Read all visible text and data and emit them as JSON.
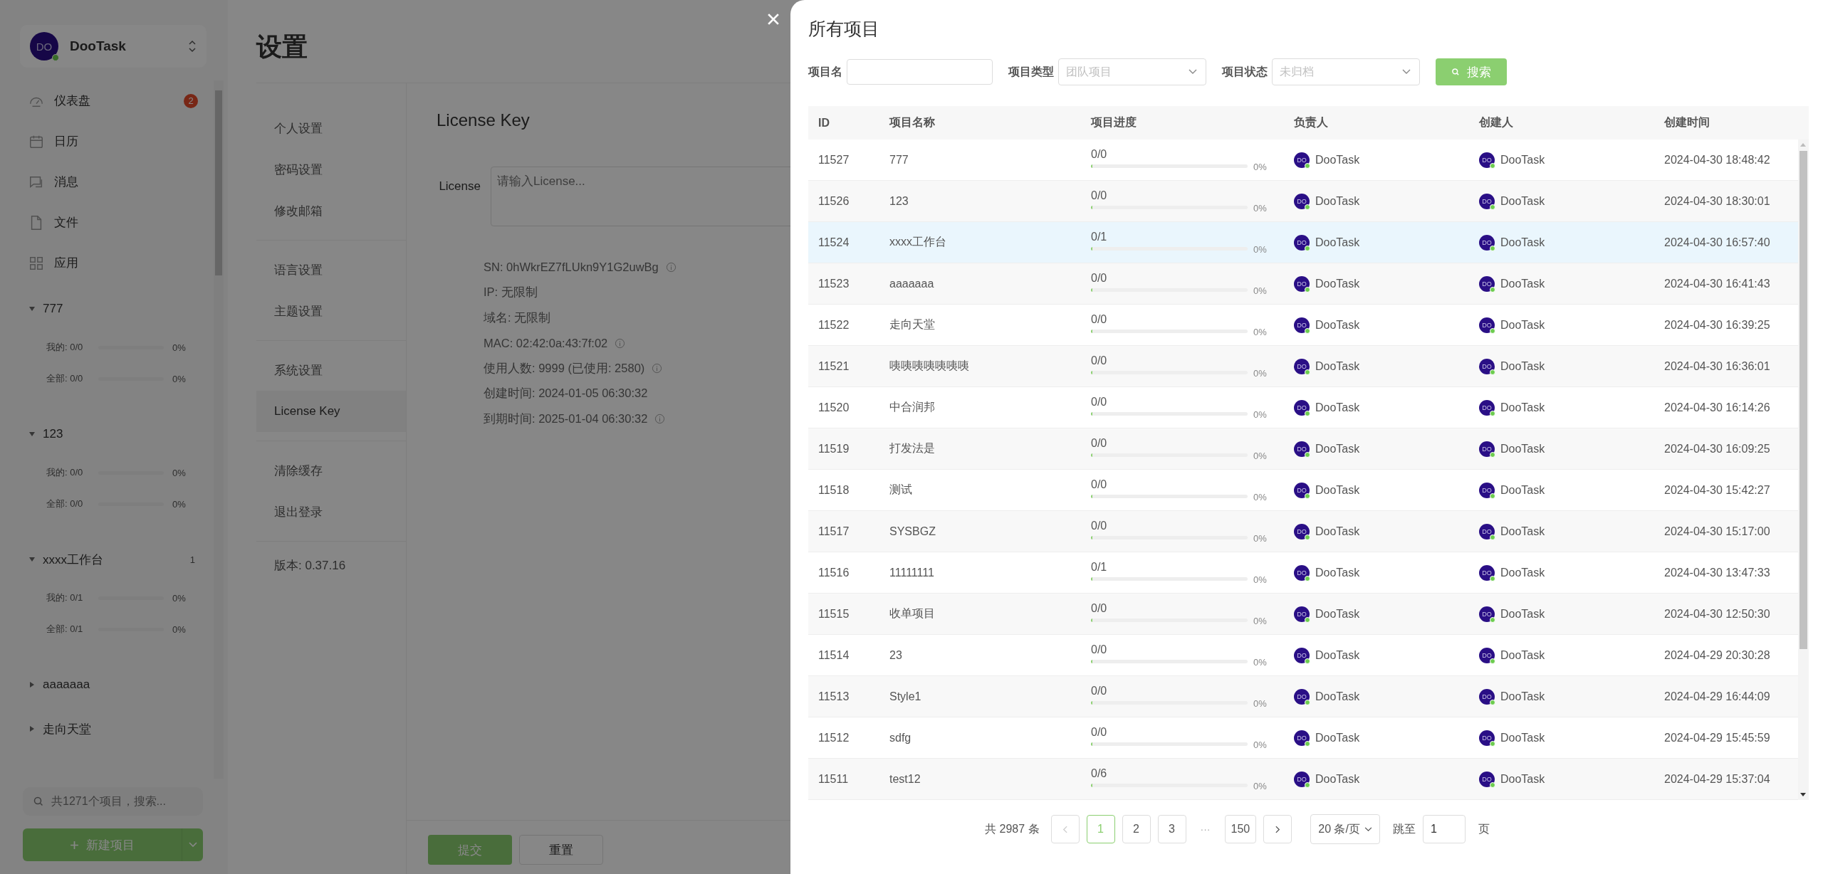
{
  "sidebar": {
    "logo": {
      "avatar": "DO",
      "name": "DooTask",
      "online": true
    },
    "menu": [
      {
        "kind": "dashboard",
        "label": "仪表盘",
        "badge": "2"
      },
      {
        "kind": "calendar",
        "label": "日历"
      },
      {
        "kind": "message",
        "label": "消息"
      },
      {
        "kind": "file",
        "label": "文件"
      },
      {
        "kind": "apps",
        "label": "应用"
      }
    ],
    "projects": [
      {
        "name": "777",
        "expanded": true,
        "stats": [
          {
            "label": "我的: 0/0",
            "level": 0,
            "percent": "0%"
          },
          {
            "label": "全部: 0/0",
            "level": 0,
            "percent": "0%"
          }
        ]
      },
      {
        "name": "123",
        "expanded": true,
        "stats": [
          {
            "label": "我的: 0/0",
            "level": 0,
            "percent": "0%"
          },
          {
            "label": "全部: 0/0",
            "level": 0,
            "percent": "0%"
          }
        ]
      },
      {
        "name": "xxxx工作台",
        "expanded": true,
        "count": "1",
        "stats": [
          {
            "label": "我的: 0/1",
            "level": 0,
            "percent": "0%"
          },
          {
            "label": "全部: 0/1",
            "level": 0,
            "percent": "0%"
          }
        ]
      },
      {
        "name": "aaaaaaa",
        "expanded": false
      },
      {
        "name": "走向天堂",
        "expanded": false
      }
    ],
    "search": {
      "placeholder": "共1271个项目，搜索..."
    },
    "new_button": {
      "label": "新建项目"
    }
  },
  "settings": {
    "title": "设置",
    "nav_groups": [
      [
        {
          "label": "个人设置",
          "selected": false
        },
        {
          "label": "密码设置",
          "selected": false
        },
        {
          "label": "修改邮箱",
          "selected": false
        }
      ],
      [
        {
          "label": "语言设置",
          "selected": false
        },
        {
          "label": "主题设置",
          "selected": false
        }
      ],
      [
        {
          "label": "系统设置",
          "selected": false
        },
        {
          "label": "License Key",
          "selected": true
        }
      ],
      [
        {
          "label": "清除缓存",
          "selected": false
        },
        {
          "label": "退出登录",
          "selected": false
        }
      ]
    ],
    "version": "版本: 0.37.16",
    "content": {
      "heading": "License Key",
      "license_label": "License",
      "license_placeholder": "请输入License...",
      "info": [
        {
          "label": "SN:",
          "value": "0hWkrEZ7fLUkn9Y1G2uwBg",
          "info_icon": true
        },
        {
          "label": "IP:",
          "value": "无限制",
          "info_icon": false
        },
        {
          "label": "域名:",
          "value": "无限制",
          "info_icon": false
        },
        {
          "label": "MAC:",
          "value": "02:42:0a:43:7f:02",
          "info_icon": true
        },
        {
          "label": "使用人数:",
          "value": "9999 (已使用: 2580)",
          "info_icon": true
        },
        {
          "label": "创建时间:",
          "value": "2024-01-05 06:30:32",
          "info_icon": false
        },
        {
          "label": "到期时间:",
          "value": "2025-01-04 06:30:32",
          "info_icon": true
        }
      ],
      "buttons": [
        {
          "kind": "primary",
          "label": "提交"
        },
        {
          "kind": "default",
          "label": "重置"
        }
      ]
    }
  },
  "drawer": {
    "title": "所有项目",
    "filters": [
      {
        "kind": "input",
        "label": "项目名"
      },
      {
        "kind": "select",
        "label": "项目类型",
        "placeholder": "团队项目"
      },
      {
        "kind": "select",
        "label": "项目状态",
        "placeholder": "未归档"
      }
    ],
    "search_button": "搜索",
    "table": {
      "columns": [
        "ID",
        "项目名称",
        "项目进度",
        "负责人",
        "创建人",
        "创建时间"
      ],
      "rows": [
        {
          "id": "11527",
          "name": "777",
          "progress": "0/0",
          "level": 0,
          "percent": "0%",
          "owner": {
            "avatar": "DO",
            "name": "DooTask",
            "online": true
          },
          "creator": {
            "avatar": "DO",
            "name": "DooTask",
            "online": true
          },
          "created": "2024-04-30 18:48:42",
          "selected": false
        },
        {
          "id": "11526",
          "name": "123",
          "progress": "0/0",
          "level": 0,
          "percent": "0%",
          "owner": {
            "avatar": "DO",
            "name": "DooTask",
            "online": true
          },
          "creator": {
            "avatar": "DO",
            "name": "DooTask",
            "online": true
          },
          "created": "2024-04-30 18:30:01",
          "selected": false
        },
        {
          "id": "11524",
          "name": "xxxx工作台",
          "progress": "0/1",
          "level": 0,
          "percent": "0%",
          "owner": {
            "avatar": "DO",
            "name": "DooTask",
            "online": true
          },
          "creator": {
            "avatar": "DO",
            "name": "DooTask",
            "online": true
          },
          "created": "2024-04-30 16:57:40",
          "selected": true
        },
        {
          "id": "11523",
          "name": "aaaaaaa",
          "progress": "0/0",
          "level": 0,
          "percent": "0%",
          "owner": {
            "avatar": "DO",
            "name": "DooTask",
            "online": true
          },
          "creator": {
            "avatar": "DO",
            "name": "DooTask",
            "online": true
          },
          "created": "2024-04-30 16:41:43",
          "selected": false
        },
        {
          "id": "11522",
          "name": "走向天堂",
          "progress": "0/0",
          "level": 0,
          "percent": "0%",
          "owner": {
            "avatar": "DO",
            "name": "DooTask",
            "online": true
          },
          "creator": {
            "avatar": "DO",
            "name": "DooTask",
            "online": true
          },
          "created": "2024-04-30 16:39:25",
          "selected": false
        },
        {
          "id": "11521",
          "name": "咦咦咦咦咦咦咦",
          "progress": "0/0",
          "level": 0,
          "percent": "0%",
          "owner": {
            "avatar": "DO",
            "name": "DooTask",
            "online": true
          },
          "creator": {
            "avatar": "DO",
            "name": "DooTask",
            "online": true
          },
          "created": "2024-04-30 16:36:01",
          "selected": false
        },
        {
          "id": "11520",
          "name": "中合润邦",
          "progress": "0/0",
          "level": 0,
          "percent": "0%",
          "owner": {
            "avatar": "DO",
            "name": "DooTask",
            "online": true
          },
          "creator": {
            "avatar": "DO",
            "name": "DooTask",
            "online": true
          },
          "created": "2024-04-30 16:14:26",
          "selected": false
        },
        {
          "id": "11519",
          "name": "打发法是",
          "progress": "0/0",
          "level": 0,
          "percent": "0%",
          "owner": {
            "avatar": "DO",
            "name": "DooTask",
            "online": true
          },
          "creator": {
            "avatar": "DO",
            "name": "DooTask",
            "online": true
          },
          "created": "2024-04-30 16:09:25",
          "selected": false
        },
        {
          "id": "11518",
          "name": "测试",
          "progress": "0/0",
          "level": 0,
          "percent": "0%",
          "owner": {
            "avatar": "DO",
            "name": "DooTask",
            "online": true
          },
          "creator": {
            "avatar": "DO",
            "name": "DooTask",
            "online": true
          },
          "created": "2024-04-30 15:42:27",
          "selected": false
        },
        {
          "id": "11517",
          "name": "SYSBGZ",
          "progress": "0/0",
          "level": 0,
          "percent": "0%",
          "owner": {
            "avatar": "DO",
            "name": "DooTask",
            "online": true
          },
          "creator": {
            "avatar": "DO",
            "name": "DooTask",
            "online": true
          },
          "created": "2024-04-30 15:17:00",
          "selected": false
        },
        {
          "id": "11516",
          "name": "11111111",
          "progress": "0/1",
          "level": 0,
          "percent": "0%",
          "owner": {
            "avatar": "DO",
            "name": "DooTask",
            "online": true
          },
          "creator": {
            "avatar": "DO",
            "name": "DooTask",
            "online": true
          },
          "created": "2024-04-30 13:47:33",
          "selected": false
        },
        {
          "id": "11515",
          "name": "收单项目",
          "progress": "0/0",
          "level": 0,
          "percent": "0%",
          "owner": {
            "avatar": "DO",
            "name": "DooTask",
            "online": true
          },
          "creator": {
            "avatar": "DO",
            "name": "DooTask",
            "online": true
          },
          "created": "2024-04-30 12:50:30",
          "selected": false
        },
        {
          "id": "11514",
          "name": "23",
          "progress": "0/0",
          "level": 0,
          "percent": "0%",
          "owner": {
            "avatar": "DO",
            "name": "DooTask",
            "online": true
          },
          "creator": {
            "avatar": "DO",
            "name": "DooTask",
            "online": true
          },
          "created": "2024-04-29 20:30:28",
          "selected": false
        },
        {
          "id": "11513",
          "name": "Style1",
          "progress": "0/0",
          "level": 0,
          "percent": "0%",
          "owner": {
            "avatar": "DO",
            "name": "DooTask",
            "online": true
          },
          "creator": {
            "avatar": "DO",
            "name": "DooTask",
            "online": true
          },
          "created": "2024-04-29 16:44:09",
          "selected": false
        },
        {
          "id": "11512",
          "name": "sdfg",
          "progress": "0/0",
          "level": 0,
          "percent": "0%",
          "owner": {
            "avatar": "DO",
            "name": "DooTask",
            "online": true
          },
          "creator": {
            "avatar": "DO",
            "name": "DooTask",
            "online": true
          },
          "created": "2024-04-29 15:45:59",
          "selected": false
        },
        {
          "id": "11511",
          "name": "test12",
          "progress": "0/6",
          "level": 0,
          "percent": "0%",
          "owner": {
            "avatar": "DO",
            "name": "DooTask",
            "online": true
          },
          "creator": {
            "avatar": "DO",
            "name": "DooTask",
            "online": true
          },
          "created": "2024-04-29 15:37:04",
          "selected": false
        }
      ]
    },
    "pagination": {
      "total": "共 2987 条",
      "prev_disabled": true,
      "next_disabled": false,
      "pages": [
        {
          "kind": "page",
          "label": "1",
          "selected": true
        },
        {
          "kind": "page",
          "label": "2",
          "selected": false
        },
        {
          "kind": "page",
          "label": "3",
          "selected": false
        },
        {
          "kind": "ellipsis",
          "label": "···",
          "selected": false
        },
        {
          "kind": "page",
          "label": "150",
          "selected": false
        }
      ],
      "page_size": "20 条/页",
      "jump_label": "跳至",
      "jump_value": "1",
      "page_suffix": "页"
    }
  }
}
